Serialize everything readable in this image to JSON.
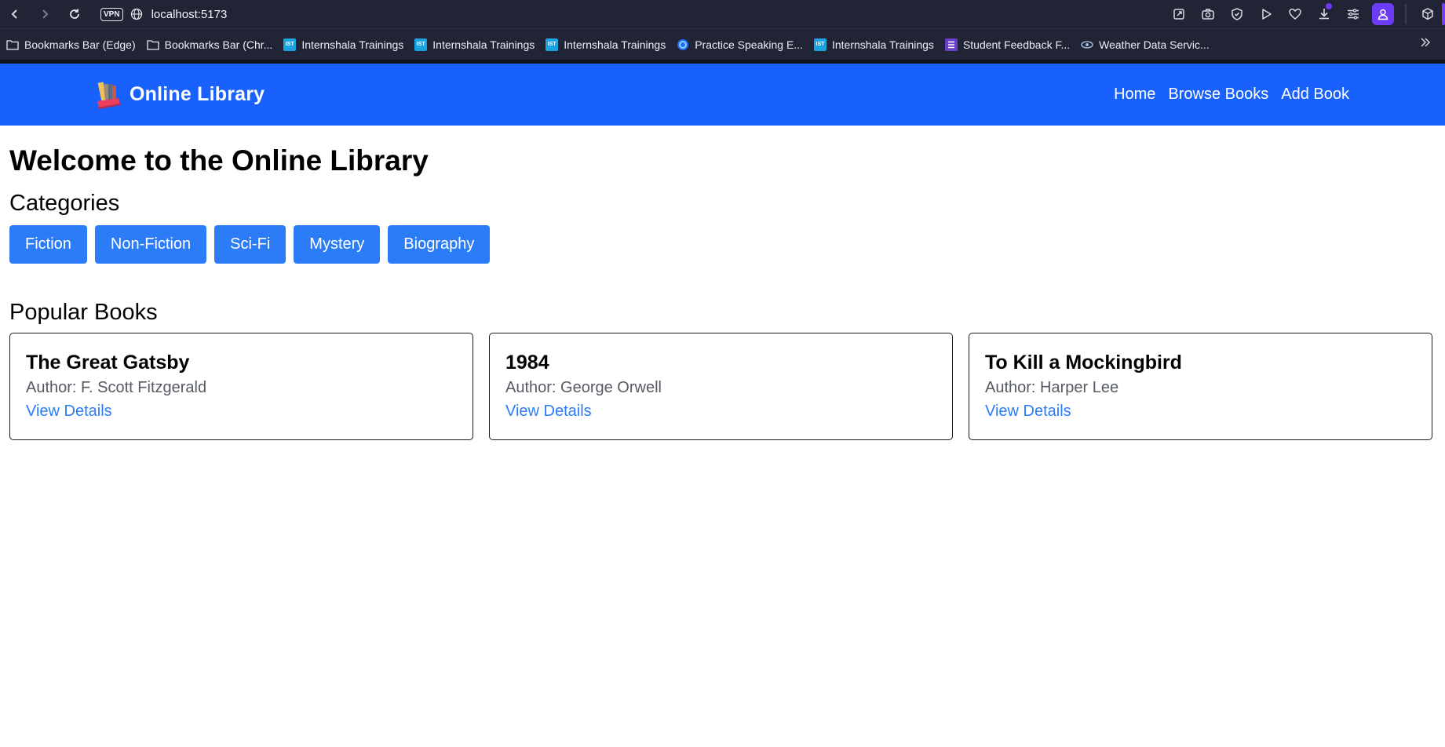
{
  "browser": {
    "url": "localhost:5173",
    "vpn_label": "VPN",
    "bookmarks": [
      {
        "label": "Bookmarks Bar (Edge)",
        "icon": "folder-icon"
      },
      {
        "label": "Bookmarks Bar (Chr...",
        "icon": "folder-icon"
      },
      {
        "label": "Internshala Trainings",
        "icon": "ist-icon"
      },
      {
        "label": "Internshala Trainings",
        "icon": "ist-icon"
      },
      {
        "label": "Internshala Trainings",
        "icon": "ist-icon"
      },
      {
        "label": "Practice Speaking E...",
        "icon": "globe-blue-icon"
      },
      {
        "label": "Internshala Trainings",
        "icon": "ist-icon"
      },
      {
        "label": "Student Feedback F...",
        "icon": "forms-icon"
      },
      {
        "label": "Weather Data Servic...",
        "icon": "eye-icon"
      }
    ],
    "ist_text": "IST"
  },
  "header": {
    "title": "Online Library",
    "nav": [
      "Home",
      "Browse Books",
      "Add Book"
    ],
    "brand_color": "#1961fd"
  },
  "main": {
    "title": "Welcome to the Online Library",
    "categories_heading": "Categories",
    "categories": [
      "Fiction",
      "Non-Fiction",
      "Sci-Fi",
      "Mystery",
      "Biography"
    ],
    "popular_heading": "Popular Books",
    "books": [
      {
        "title": "The Great Gatsby",
        "author": "Author: F. Scott Fitzgerald",
        "link": "View Details"
      },
      {
        "title": "1984",
        "author": "Author: George Orwell",
        "link": "View Details"
      },
      {
        "title": "To Kill a Mockingbird",
        "author": "Author: Harper Lee",
        "link": "View Details"
      }
    ],
    "accent_color": "#2b7cf6"
  }
}
